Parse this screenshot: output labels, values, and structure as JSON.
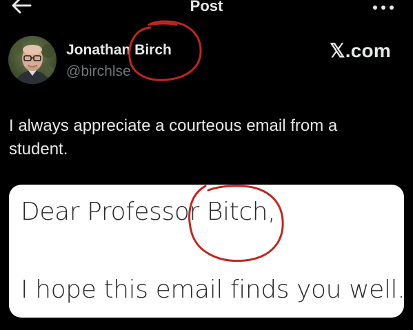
{
  "header": {
    "title": "Post",
    "back_icon": "arrow-left-icon",
    "more_icon": "more-horizontal-icon"
  },
  "post": {
    "author": {
      "display_name": "Jonathan Birch",
      "handle": "@birchlse",
      "avatar_icon": "avatar-photo"
    },
    "watermark": "𝕏.com",
    "text": "I always appreciate a courteous email from a student.",
    "media": {
      "line1": "Dear Professor Bitch,",
      "line2": "I hope this email finds you well."
    }
  },
  "annotation": {
    "color": "#c0261e",
    "icon": "hand-drawn-circle"
  },
  "colors": {
    "background": "#000000",
    "text_primary": "#e7e9ea",
    "text_secondary": "#71767b",
    "card_background": "#ffffff"
  }
}
